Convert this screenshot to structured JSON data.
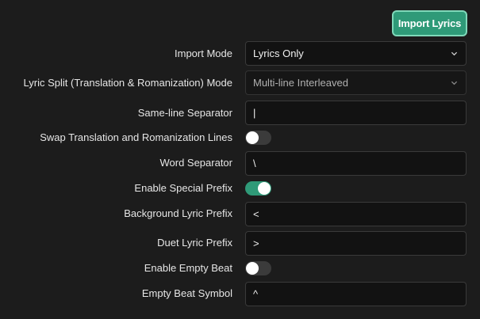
{
  "header": {
    "import_button": "Import Lyrics"
  },
  "form": {
    "import_mode": {
      "label": "Import Mode",
      "value": "Lyrics Only",
      "icon": "chevron-down-icon"
    },
    "split_mode": {
      "label": "Lyric Split (Translation & Romanization) Mode",
      "value": "Multi-line Interleaved",
      "icon": "chevron-down-icon"
    },
    "same_line_separator": {
      "label": "Same-line Separator",
      "value": "|"
    },
    "swap_lines": {
      "label": "Swap Translation and Romanization Lines",
      "enabled": false
    },
    "word_separator": {
      "label": "Word Separator",
      "value": "\\"
    },
    "special_prefix": {
      "label": "Enable Special Prefix",
      "enabled": true
    },
    "background_prefix": {
      "label": "Background Lyric Prefix",
      "value": "<"
    },
    "duet_prefix": {
      "label": "Duet Lyric Prefix",
      "value": ">"
    },
    "empty_beat": {
      "label": "Enable Empty Beat",
      "enabled": false
    },
    "empty_beat_symbol": {
      "label": "Empty Beat Symbol",
      "value": "^"
    }
  },
  "colors": {
    "background": "#1c1c1c",
    "accent": "#2f9a78",
    "accent_border": "#7fd8b9",
    "field_bg": "#121212",
    "toggle_off": "#3b3b3b"
  }
}
